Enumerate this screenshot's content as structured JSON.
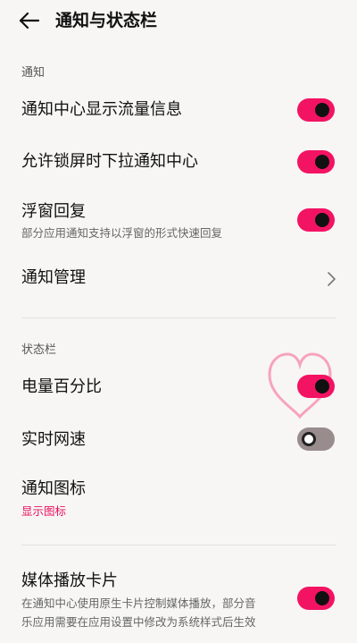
{
  "header": {
    "title": "通知与状态栏"
  },
  "sections": {
    "notify_label": "通知",
    "status_label": "状态栏"
  },
  "rows": {
    "traffic": {
      "title": "通知中心显示流量信息",
      "on": true
    },
    "lockscreen": {
      "title": "允许锁屏时下拉通知中心",
      "on": true
    },
    "float": {
      "title": "浮窗回复",
      "sub": "部分应用通知支持以浮窗的形式快速回复",
      "on": true
    },
    "manage": {
      "title": "通知管理"
    },
    "battery": {
      "title": "电量百分比",
      "on": true
    },
    "netspeed": {
      "title": "实时网速",
      "on": false
    },
    "icon": {
      "title": "通知图标",
      "link": "显示图标"
    },
    "media": {
      "title": "媒体播放卡片",
      "sub_line1": "在通知中心使用原生卡片控制媒体播放，部分音",
      "sub_line2": "乐应用需要在应用设置中修改为系统样式后生效",
      "on": true
    }
  },
  "colors": {
    "accent": "#f31363",
    "toggle_off": "#988c8c",
    "background": "#f7f6f5"
  },
  "icons": [
    "back-arrow-icon",
    "chevron-right-icon",
    "heart-icon"
  ]
}
